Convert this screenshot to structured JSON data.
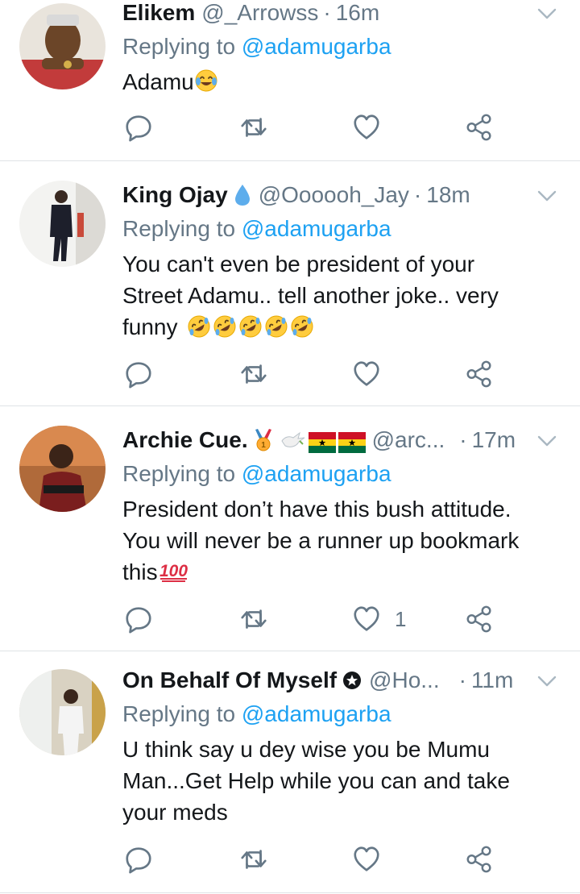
{
  "tweets": [
    {
      "name": "Elikem",
      "handle": "@_Arrowss",
      "time": "16m",
      "replying_prefix": "Replying to",
      "replying_to": "@adamugarba",
      "text": "Adamu",
      "text_emoji": "joy-emoji",
      "like_count": ""
    },
    {
      "name": "King Ojay",
      "name_emoji": "droplet-emoji",
      "handle": "@Oooooh_Jay",
      "time": "18m",
      "replying_prefix": "Replying to",
      "replying_to": "@adamugarba",
      "text_lines": [
        "You can't even be president of your",
        "Street Adamu.. tell another joke.. very",
        "funny"
      ],
      "text_emoji": "rofl-emoji",
      "like_count": ""
    },
    {
      "name": "Archie Cue.",
      "name_emoji": [
        "gold-medal-emoji",
        "dove-emoji",
        "ghana-flag-emoji",
        "ghana-flag-emoji"
      ],
      "handle": "@arc...",
      "time": "17m",
      "replying_prefix": "Replying to",
      "replying_to": "@adamugarba",
      "text_lines": [
        "President don’t have this bush attitude.",
        "You will never be a runner up bookmark",
        "this"
      ],
      "text_emoji": "hundred-points-emoji",
      "like_count": "1"
    },
    {
      "name": "On Behalf Of Myself",
      "name_emoji": "star-circle-icon",
      "handle": "@Ho...",
      "time": "11m",
      "replying_prefix": "Replying to",
      "replying_to": "@adamugarba",
      "text_lines": [
        "U think say u dey wise you be Mumu",
        "Man...Get Help while you can and take",
        "your meds"
      ],
      "like_count": ""
    }
  ],
  "colors": {
    "text": "#14171a",
    "secondary": "#657786",
    "link": "#1da1f2",
    "divider": "#dfe3e6"
  }
}
